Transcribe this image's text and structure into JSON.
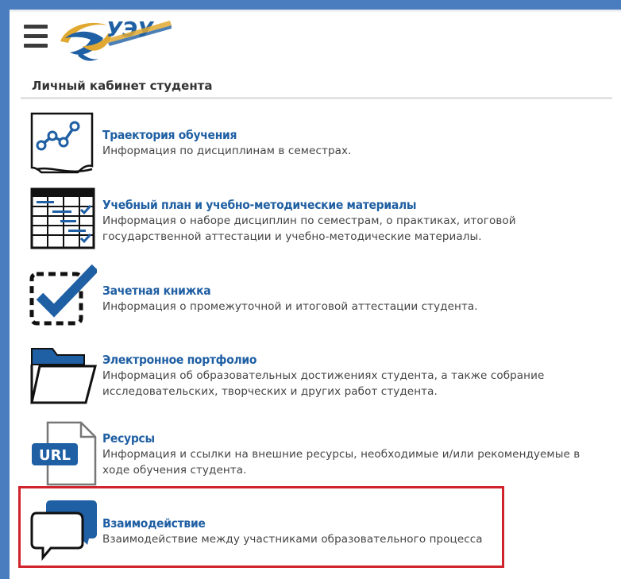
{
  "header": {
    "menu_icon": "hamburger-menu-icon",
    "logo_icon": "university-logo"
  },
  "section": {
    "title": "Личный кабинет студента"
  },
  "items": [
    {
      "title": "Траектория обучения",
      "description": "Информация по дисциплинам в семестрах.",
      "icon": "trajectory-chart-icon"
    },
    {
      "title": "Учебный план и учебно-методические материалы",
      "description": "Информация о наборе дисциплин по семестрам, о практиках, итоговой государственной аттестации и учебно-методические материалы.",
      "icon": "curriculum-table-icon"
    },
    {
      "title": "Зачетная книжка",
      "description": "Информация о промежуточной и итоговой аттестации студента.",
      "icon": "checkmark-icon"
    },
    {
      "title": "Электронное портфолио",
      "description": "Информация об образовательных достижениях студента, а также собрание исследовательских, творческих и других работ студента.",
      "icon": "folder-icon"
    },
    {
      "title": "Ресурсы",
      "description": "Информация и ссылки на внешние ресурсы, необходимые и/или рекомендуемые в ходе обучения студента.",
      "icon": "url-document-icon"
    },
    {
      "title": "Взаимодействие",
      "description": "Взаимодействие между участниками образовательного процесса",
      "icon": "chat-bubbles-icon"
    }
  ],
  "colors": {
    "frame": "#4a7dbf",
    "link": "#1f5fa3",
    "highlight": "#d0232c"
  }
}
